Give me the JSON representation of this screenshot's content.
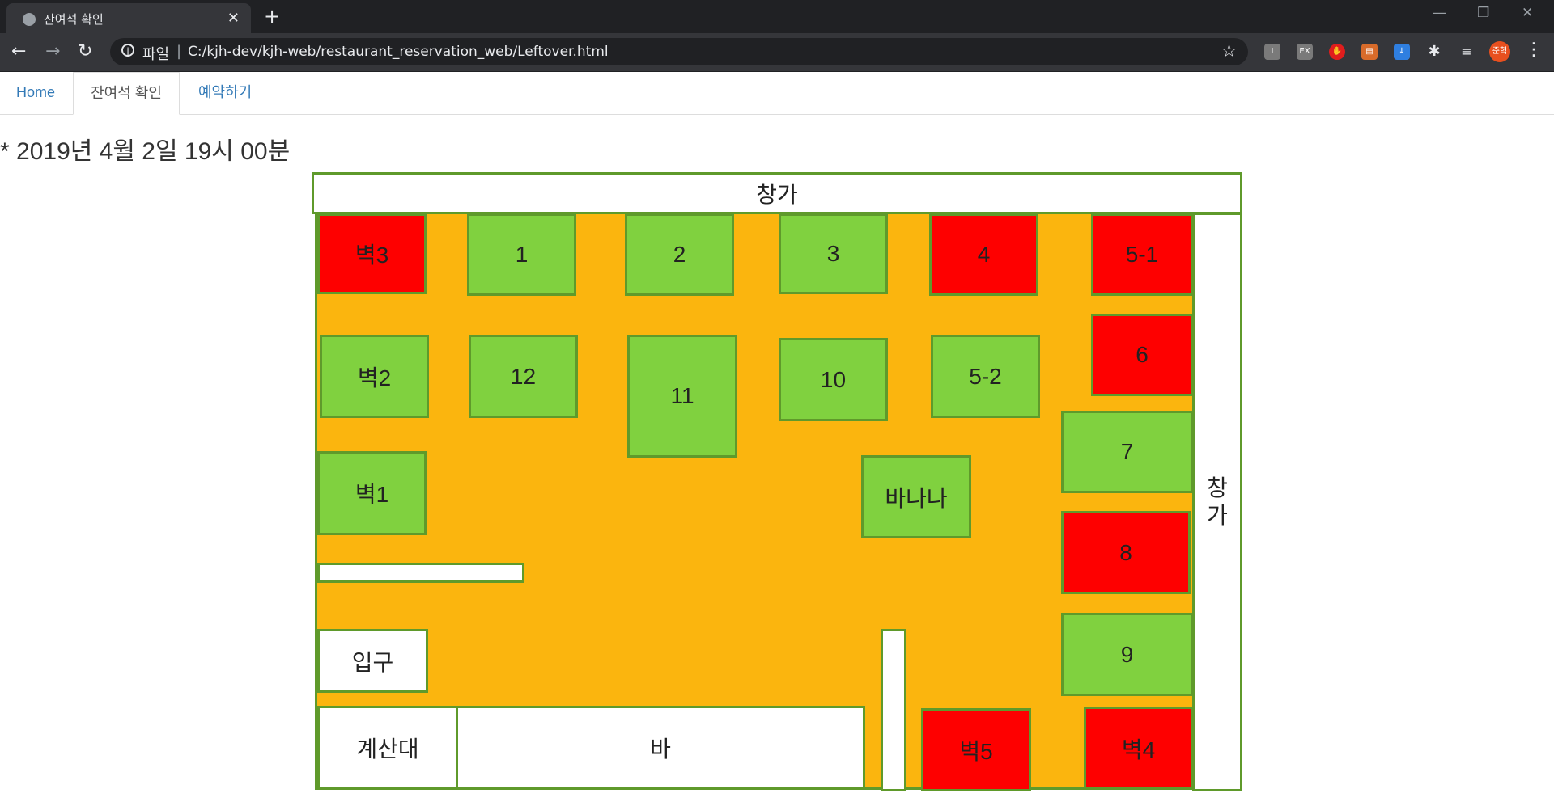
{
  "browser": {
    "tab_title": "잔여석 확인",
    "tab_close": "✕",
    "new_tab": "+",
    "scheme_label": "파일",
    "url": "C:/kjh-dev/kjh-web/restaurant_reservation_web/Leftover.html",
    "avatar_label": "준혁",
    "nav": {
      "back": "←",
      "forward": "→",
      "reload": "↻"
    },
    "star": "☆",
    "menu": "⋮"
  },
  "nav": {
    "home": "Home",
    "leftover": "잔여석 확인",
    "reserve": "예약하기"
  },
  "datetime": "* 2019년 4월 2일 19시 00분",
  "floor": {
    "window_top": "창가",
    "window_right": [
      "창",
      "가"
    ],
    "entrance": "입구",
    "counter": "계산대",
    "bar": "바"
  },
  "colors": {
    "available": "#80d13f",
    "occupied": "#fe0000",
    "floor": "#fbb50e",
    "border": "#5f9a2b"
  },
  "tables": [
    {
      "label": "벽3",
      "status": "occupied"
    },
    {
      "label": "1",
      "status": "available"
    },
    {
      "label": "2",
      "status": "available"
    },
    {
      "label": "3",
      "status": "available"
    },
    {
      "label": "4",
      "status": "occupied"
    },
    {
      "label": "5-1",
      "status": "occupied"
    },
    {
      "label": "벽2",
      "status": "available"
    },
    {
      "label": "12",
      "status": "available"
    },
    {
      "label": "11",
      "status": "available"
    },
    {
      "label": "10",
      "status": "available"
    },
    {
      "label": "5-2",
      "status": "available"
    },
    {
      "label": "6",
      "status": "occupied"
    },
    {
      "label": "7",
      "status": "available"
    },
    {
      "label": "벽1",
      "status": "available"
    },
    {
      "label": "바나나",
      "status": "available"
    },
    {
      "label": "8",
      "status": "occupied"
    },
    {
      "label": "9",
      "status": "available"
    },
    {
      "label": "벽5",
      "status": "occupied"
    },
    {
      "label": "벽4",
      "status": "occupied"
    }
  ]
}
